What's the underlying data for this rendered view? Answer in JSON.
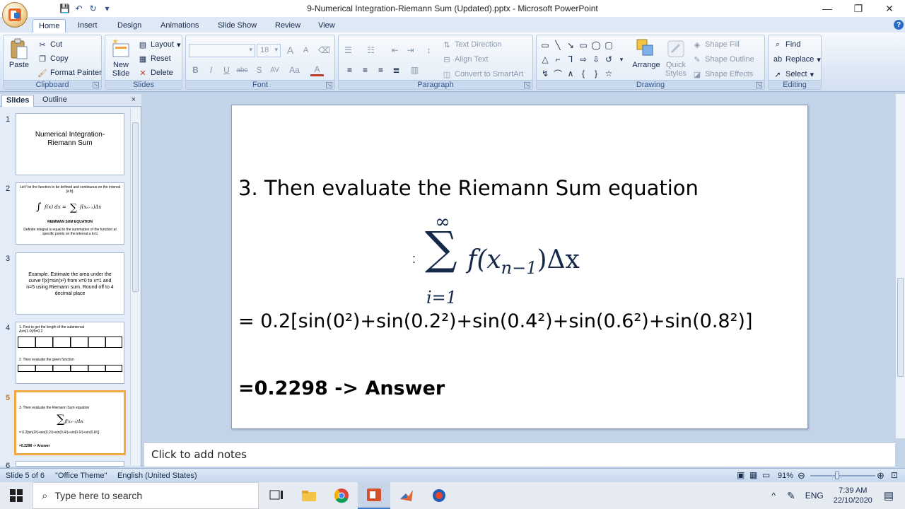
{
  "window": {
    "title": "9-Numerical Integration-Riemann Sum (Updated).pptx - Microsoft PowerPoint",
    "controls": {
      "minimize": "—",
      "maximize": "❐",
      "close": "✕"
    }
  },
  "quick_access": {
    "save": "💾",
    "undo": "↶",
    "redo": "↻",
    "customize": "▾"
  },
  "tabs": [
    "Home",
    "Insert",
    "Design",
    "Animations",
    "Slide Show",
    "Review",
    "View"
  ],
  "ribbon": {
    "clipboard": {
      "label": "Clipboard",
      "paste": "Paste",
      "cut": "Cut",
      "copy": "Copy",
      "format_painter": "Format Painter"
    },
    "slides": {
      "label": "Slides",
      "new_slide": "New Slide",
      "layout": "Layout",
      "reset": "Reset",
      "delete": "Delete"
    },
    "font": {
      "label": "Font",
      "font_size": "18",
      "bold": "B",
      "italic": "I",
      "underline": "U",
      "strike": "abc",
      "shadow": "S",
      "spacing": "AV",
      "case": "Aa",
      "color": "A",
      "grow": "A",
      "shrink": "A"
    },
    "paragraph": {
      "label": "Paragraph",
      "text_direction": "Text Direction",
      "align_text": "Align Text",
      "convert": "Convert to SmartArt"
    },
    "drawing": {
      "label": "Drawing",
      "arrange": "Arrange",
      "quick_styles": "Quick Styles",
      "shape_fill": "Shape Fill",
      "shape_outline": "Shape Outline",
      "shape_effects": "Shape Effects"
    },
    "editing": {
      "label": "Editing",
      "find": "Find",
      "replace": "Replace",
      "select": "Select"
    }
  },
  "panel": {
    "tab_slides": "Slides",
    "tab_outline": "Outline",
    "close": "×"
  },
  "thumbnails": [
    {
      "num": "1",
      "title": "Numerical Integration- Riemann Sum"
    },
    {
      "num": "2",
      "line1": "Let f be the function to be defined and continuous on the interval [a b].",
      "caption": "REIMMAN SUM EQUATION",
      "note": "Definite integral is equal to the summation of the function at specific points on the interval a to b"
    },
    {
      "num": "3",
      "text": "Example. Estimate the area under the curve f(x)=sin(x²) from x=0 to x=1 and n=5 using Riemann sum. Round off to 4 decimal place"
    },
    {
      "num": "4",
      "step1": "1. First to get the length of the subinterval Δx=(1-0)/5=0.2",
      "step2": "2. Then evaluate the given function"
    },
    {
      "num": "5",
      "heading": "3. Then evaluate the Riemann Sum equation",
      "expr": "= 0.2[sin(0²)+sin(0.2²)+sin(0.4²)+sin(0.6²)+sin(0.8²)]",
      "answer": "=0.2298 -> Answer"
    },
    {
      "num": "6"
    }
  ],
  "slide": {
    "heading": "3. Then evaluate the Riemann Sum equation",
    "sum_upper": "∞",
    "sum_lower": "i=1",
    "summand": "f(x",
    "subscript": "n−1",
    "summand_tail": ")Δx",
    "expr": "= 0.2[sin(0²)+sin(0.2²)+sin(0.4²)+sin(0.6²)+sin(0.8²)]",
    "answer": "=0.2298 -> Answer"
  },
  "notes": {
    "placeholder": "Click to add notes"
  },
  "status": {
    "slide_info": "Slide 5 of 6",
    "theme": "\"Office Theme\"",
    "language": "English (United States)",
    "zoom": "91%"
  },
  "taskbar": {
    "search_placeholder": "Type here to search",
    "language": "ENG",
    "time": "7:39 AM",
    "date": "22/10/2020"
  },
  "colors": {
    "accent": "#f3a942",
    "ribbon": "#dbe6f4",
    "slide_bg": "#ffffff"
  }
}
